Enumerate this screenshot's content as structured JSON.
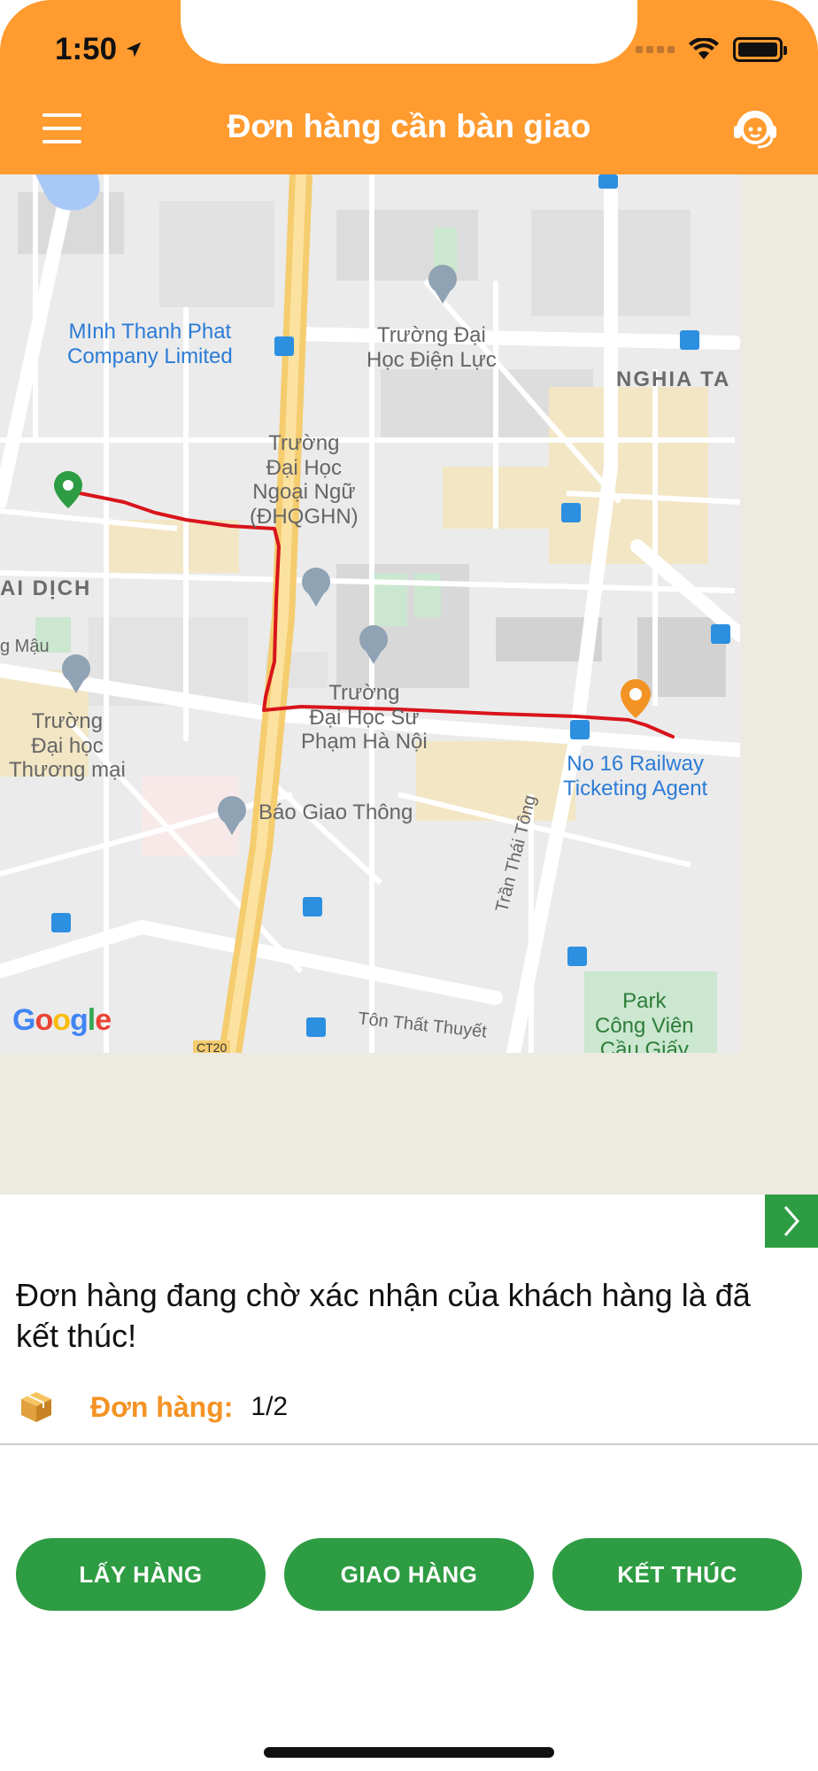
{
  "status_bar": {
    "time": "1:50"
  },
  "header": {
    "title": "Đơn hàng cần bàn giao",
    "menu_icon": "hamburger-menu-icon",
    "support_icon": "customer-support-headset-icon"
  },
  "map": {
    "labels": {
      "minh_thanh_phat": "MInh Thanh Phat\nCompany Limited",
      "truong_dai_hoc_dien_luc": "Trường Đại\nHọc Điện Lực",
      "nghia_ta": "NGHIA TA",
      "truong_ngoai_ngu": "Trường\nĐại Học\nNgoại Ngữ\n(ĐHQGHN)",
      "ai_dich": "AI DỊCH",
      "g_mau": "g Mậu",
      "truong_thuong_mai": "Trường\nĐại học\nThương mại",
      "truong_su_pham": "Trường\nĐại Học Sư\nPhạm Hà Nội",
      "railway_agent": "No 16 Railway\nTicketing Agent",
      "bao_giao_thong": "Báo Giao Thông",
      "tran_thai_tong": "Trần Thái Tông",
      "ton_that_thuyet": "Tôn Thất Thuyết",
      "park": "Park\nCông Viên\nCầu Giấy",
      "ct20": "CT20"
    },
    "google_logo": [
      "G",
      "o",
      "o",
      "g",
      "l",
      "e"
    ],
    "route_color": "#D9141B",
    "start_pin_color": "#2E9C42",
    "end_pin_color": "#F39324"
  },
  "content": {
    "message": "Đơn hàng đang chờ xác nhận của khách hàng là đã kết thúc!",
    "order_label": "Đơn hàng:",
    "order_value": "1/2",
    "order_icon": "package-box-icon"
  },
  "actions": {
    "pickup": "LẤY HÀNG",
    "deliver": "GIAO HÀNG",
    "finish": "KẾT THÚC",
    "next_icon": "chevron-right-icon"
  },
  "colors": {
    "header": "#FF9B2F",
    "button": "#2E9C42",
    "accent": "#F39324"
  }
}
